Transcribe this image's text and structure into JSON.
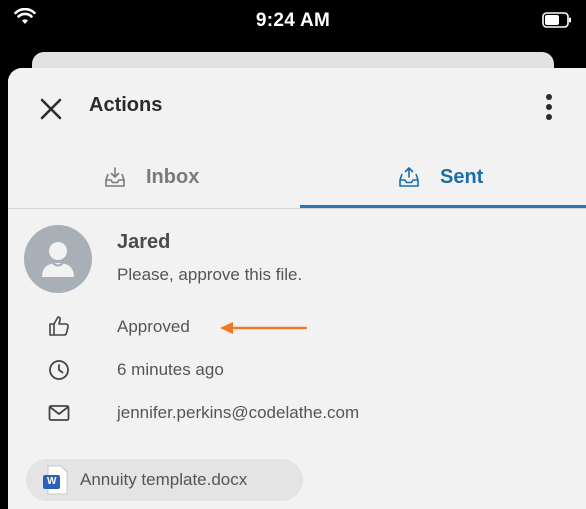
{
  "status_bar": {
    "time": "9:24 AM",
    "wifi_icon": "wifi-icon",
    "battery_icon": "battery-icon"
  },
  "header": {
    "title": "Actions",
    "close_icon": "close-icon",
    "more_icon": "more-vertical-icon"
  },
  "tabs": [
    {
      "label": "Inbox",
      "icon": "inbox-tray-icon",
      "active": false
    },
    {
      "label": "Sent",
      "icon": "sent-tray-icon",
      "active": true
    }
  ],
  "action": {
    "sender_name": "Jared",
    "message": "Please, approve this file.",
    "status": "Approved",
    "time_ago": "6 minutes ago",
    "email": "jennifer.perkins@codelathe.com",
    "file_name": "Annuity template.docx",
    "file_icon_letter": "W"
  },
  "colors": {
    "accent": "#2878b4",
    "arrow": "#f07a2a",
    "word_blue": "#2b62b8"
  }
}
